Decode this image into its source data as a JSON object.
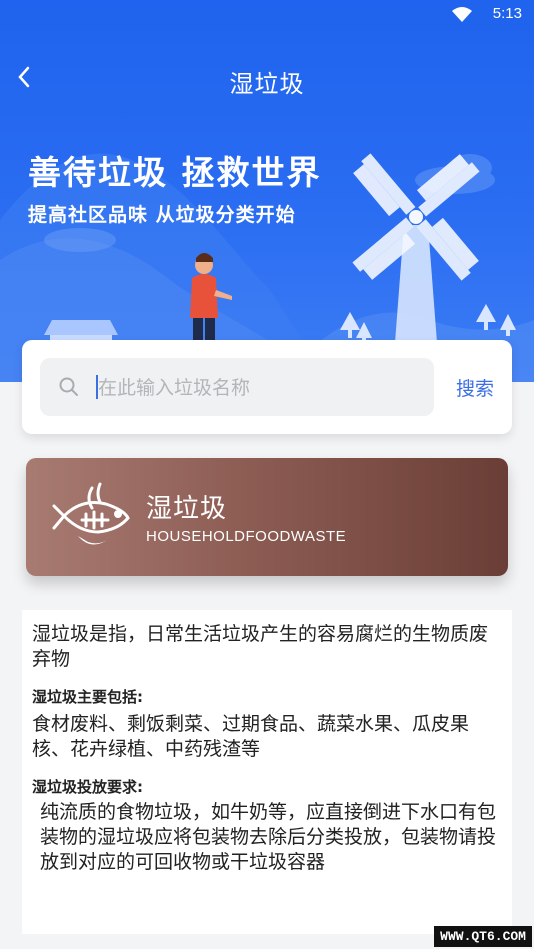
{
  "status_bar": {
    "time": "5:13"
  },
  "nav": {
    "title": "湿垃圾"
  },
  "banner": {
    "headline": "善待垃圾 拯救世界",
    "subline": "提高社区品味 从垃圾分类开始"
  },
  "search": {
    "placeholder": "在此输入垃圾名称",
    "button_label": "搜索"
  },
  "category": {
    "name": "湿垃圾",
    "english": "HOUSEHOLDFOODWASTE",
    "color_start": "#a87b72",
    "color_end": "#6a3e36"
  },
  "description": {
    "intro": "湿垃圾是指，日常生活垃圾产生的容易腐烂的生物质废弃物",
    "includes_title": "湿垃圾主要包括:",
    "includes_text": "食材废料、剩饭剩菜、过期食品、蔬菜水果、瓜皮果核、花卉绿植、中药残渣等",
    "requirements_title": "湿垃圾投放要求:",
    "requirements_text": "纯流质的食物垃圾，如牛奶等，应直接倒进下水口有包装物的湿垃圾应将包装物去除后分类投放，包装物请投放到对应的可回收物或干垃圾容器"
  },
  "watermark": "WWW.QT6.COM",
  "colors": {
    "primary": "#2a6df2",
    "accent": "#3b6fe6"
  }
}
